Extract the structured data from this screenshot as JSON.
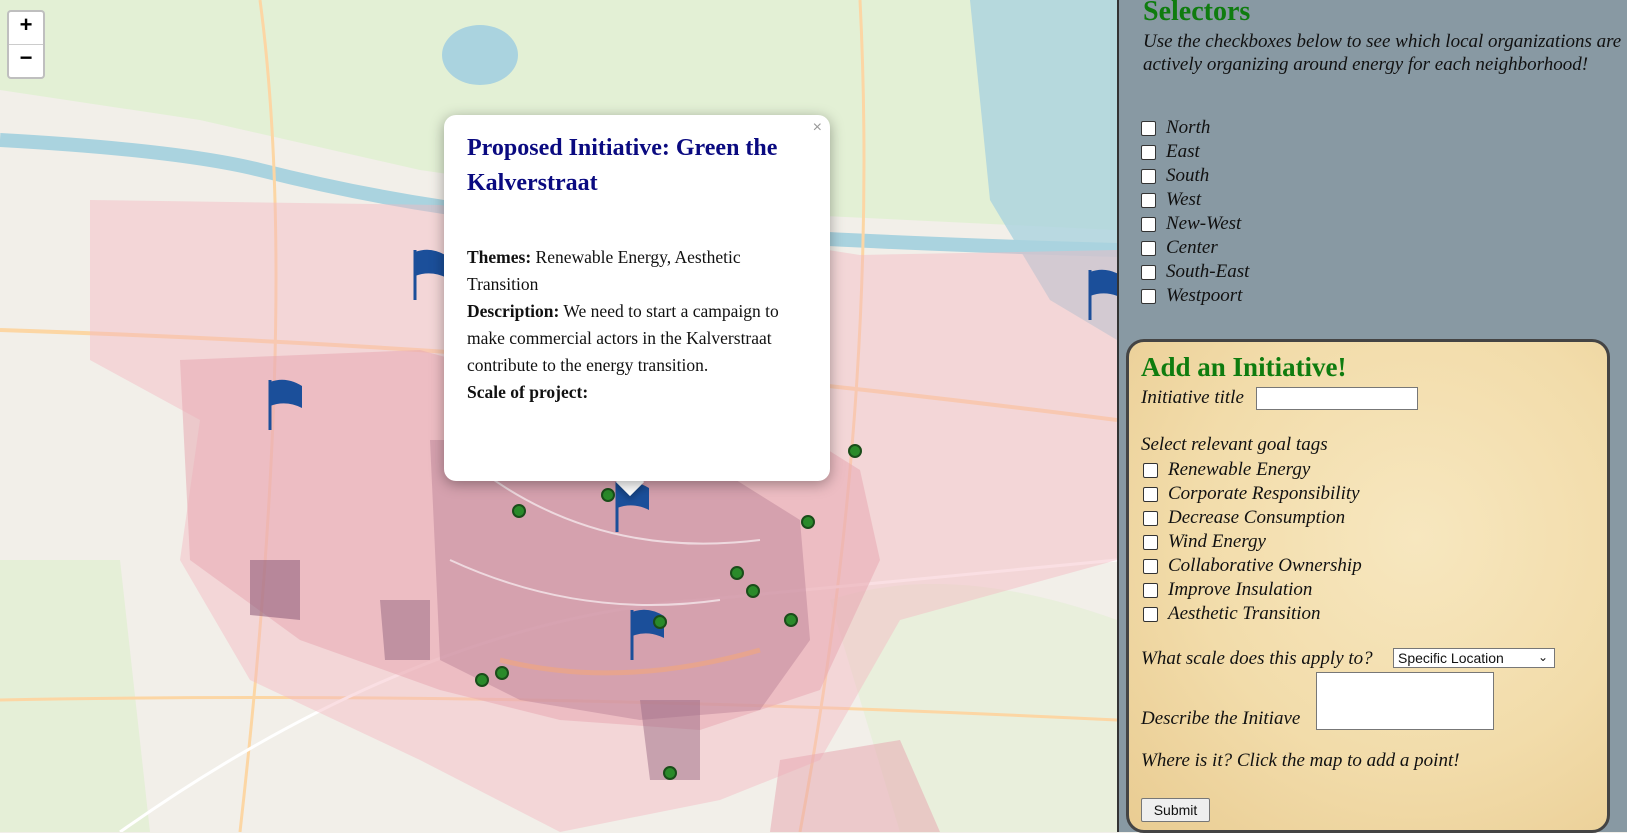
{
  "map": {
    "zoom_in": "+",
    "zoom_out": "−",
    "close_glyph": "×",
    "popup": {
      "title": "Proposed Initiative: Green the Kalverstraat",
      "themes_label": "Themes:",
      "themes_value": " Renewable Energy, Aesthetic Transition",
      "description_label": "Description:",
      "description_value": " We need to start a campaign to make commercial actors in the Kalverstraat contribute to the energy transition.",
      "scale_label": "Scale of project:"
    },
    "marker_icons": {
      "flag": "flag-icon",
      "point": "circle-marker-icon"
    },
    "colors": {
      "district_fill": "#e7a9b3",
      "district_dark": "#9c6b86",
      "flag": "#1b4f9a",
      "point": "#2a8a2a"
    }
  },
  "sidebar": {
    "selectors_title": "Selectors",
    "selectors_description": "Use the checkboxes below to see which local organizations are actively organizing around energy for each neighborhood!",
    "neighborhoods": [
      "North",
      "East",
      "South",
      "West",
      "New-West",
      "Center",
      "South-East",
      "Westpoort"
    ],
    "form": {
      "title": "Add an Initiative!",
      "title_label": "Initiative title",
      "title_value": "",
      "tags_label": "Select relevant goal tags",
      "tags": [
        "Renewable Energy",
        "Corporate Responsibility",
        "Decrease Consumption",
        "Wind Energy",
        "Collaborative Ownership",
        "Improve Insulation",
        "Aesthetic Transition"
      ],
      "scale_label": "What scale does this apply to?",
      "scale_selected": "Specific Location",
      "describe_label": "Describe the Initiave",
      "describe_value": "",
      "location_hint": "Where is it? Click the map to add a point!",
      "submit_label": "Submit"
    }
  }
}
